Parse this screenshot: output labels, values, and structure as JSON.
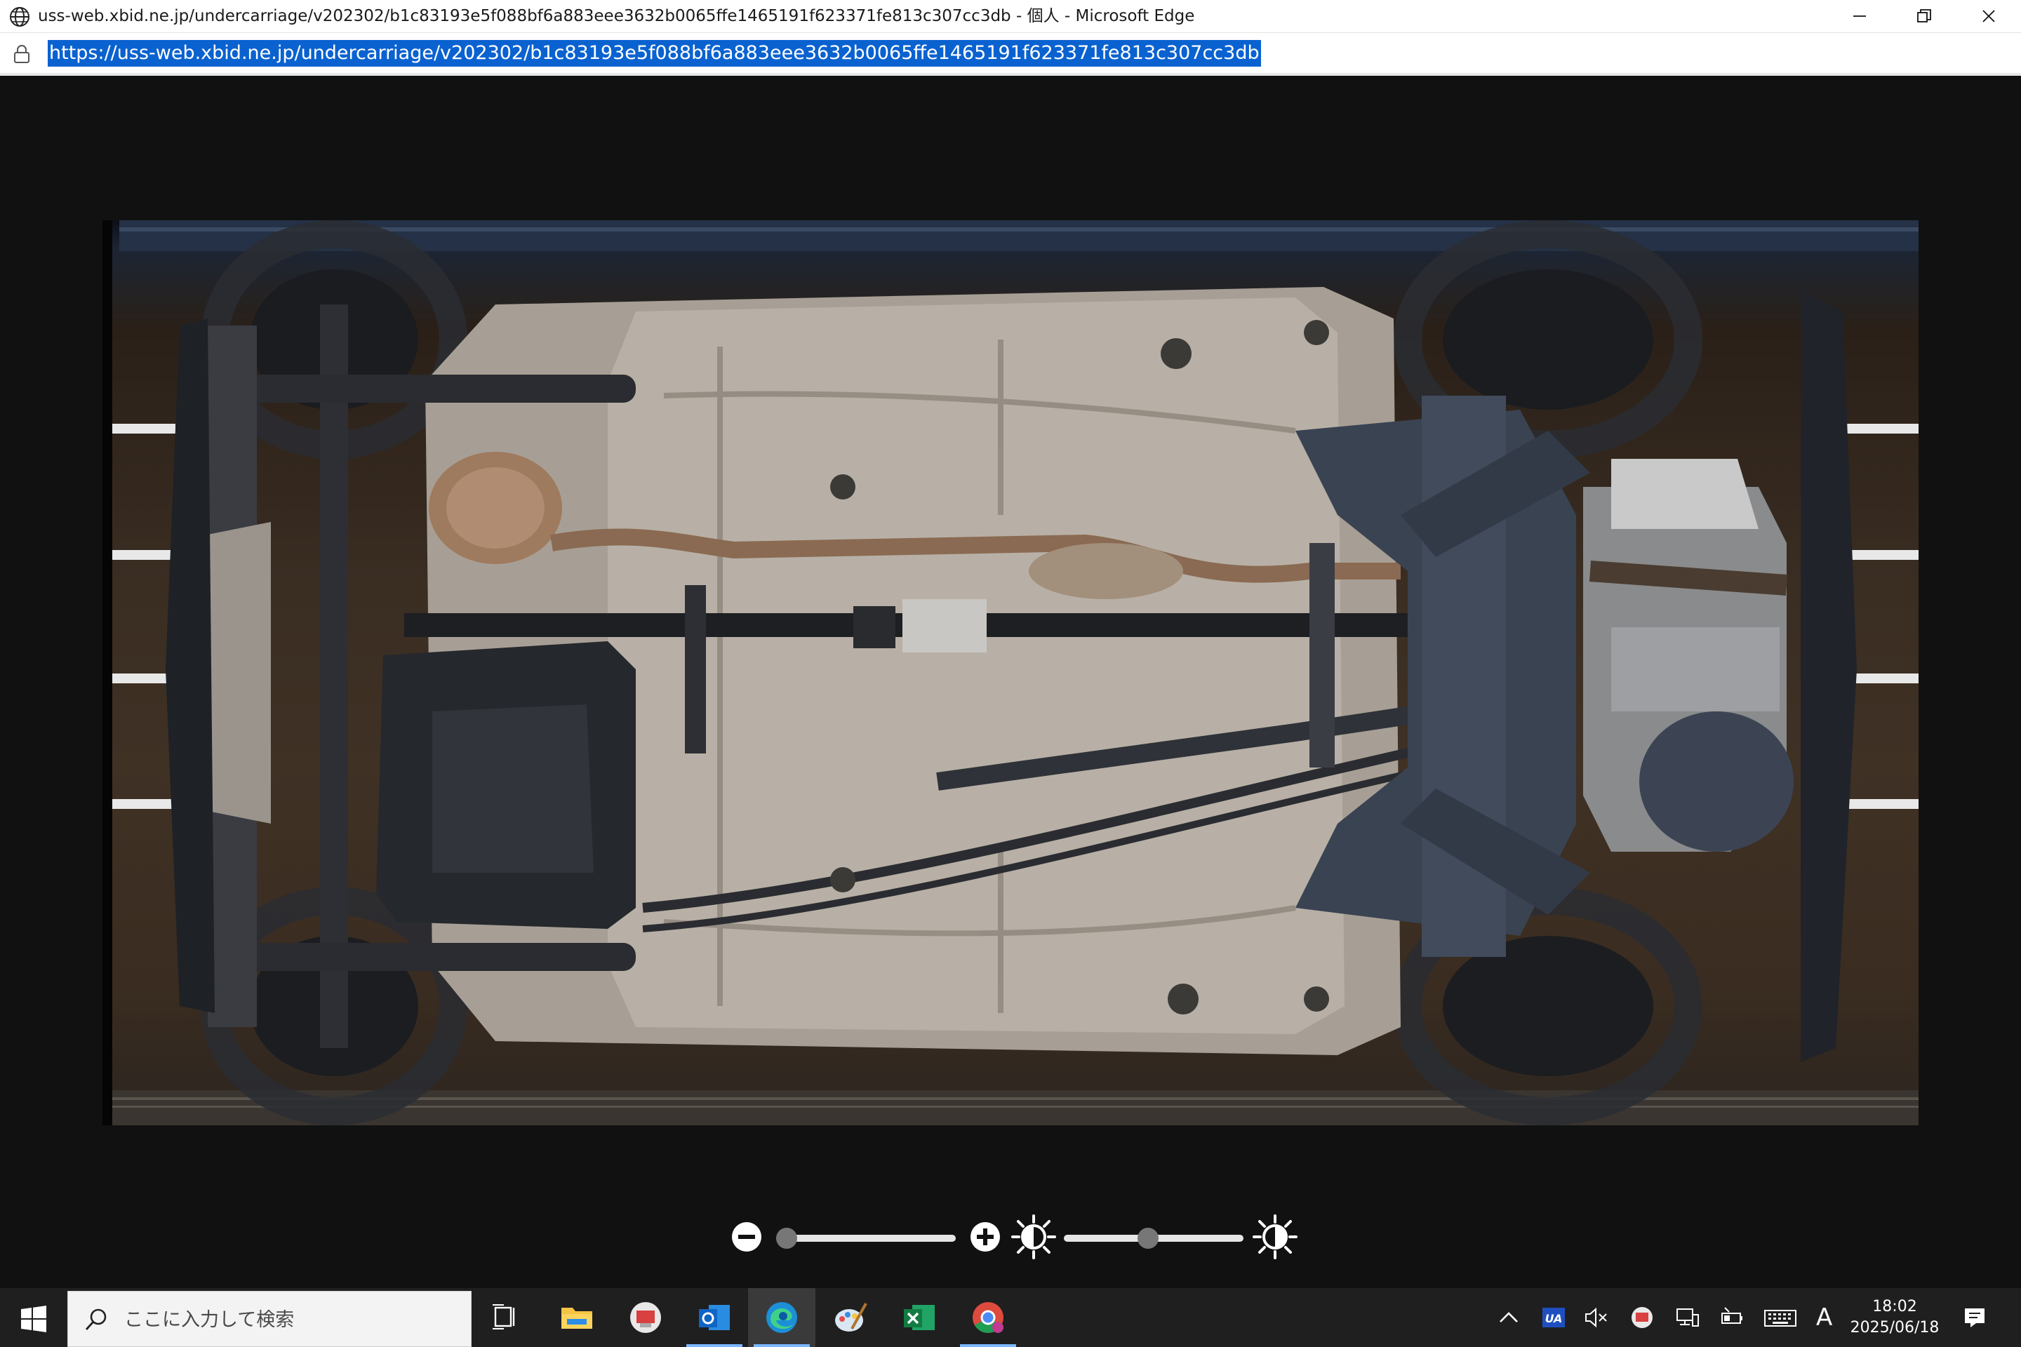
{
  "window": {
    "title": "uss-web.xbid.ne.jp/undercarriage/v202302/b1c83193e5f088bf6a883eee3632b0065ffe1465191f623371fe813c307cc3db - 個人 - Microsoft Edge"
  },
  "addressbar": {
    "url": "https://uss-web.xbid.ne.jp/undercarriage/v202302/b1c83193e5f088bf6a883eee3632b0065ffe1465191f623371fe813c307cc3db"
  },
  "viewer": {
    "zoom_level": 0.0,
    "brightness_level": 0.47
  },
  "taskbar": {
    "search_placeholder": "ここに入力して検索",
    "ime_mode": "A",
    "time": "18:02",
    "date": "2025/06/18"
  },
  "colors": {
    "url_selection": "#0a62d0",
    "taskbar": "#1f1f1f",
    "viewer_bg": "#111111",
    "active_underline": "#7ab7ff"
  }
}
